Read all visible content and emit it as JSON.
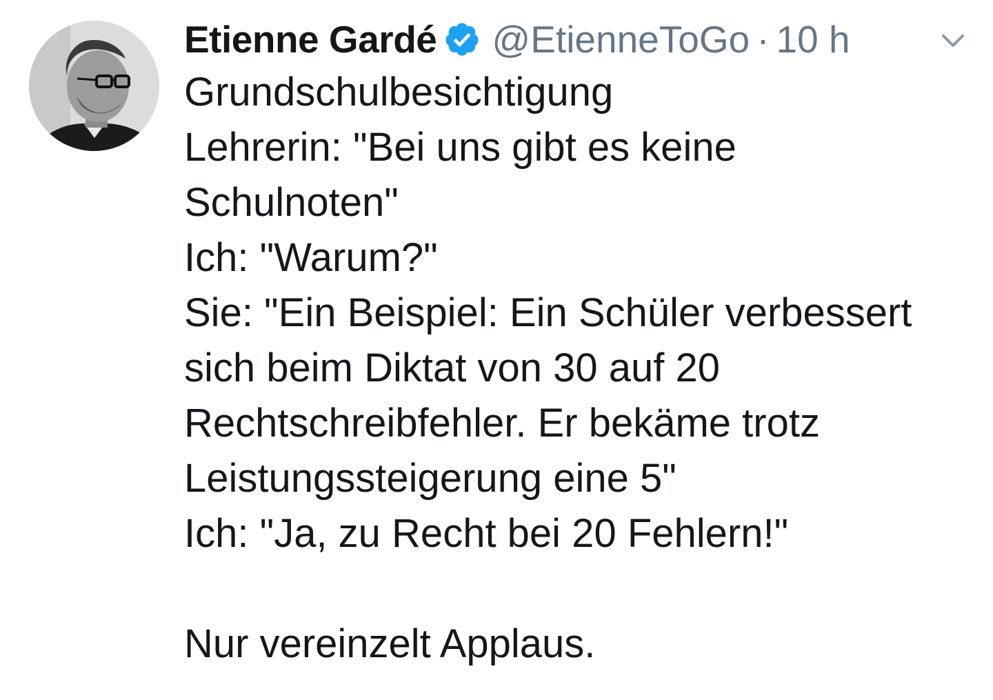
{
  "tweet": {
    "display_name": "Etienne Gardé",
    "verified": true,
    "handle": "@EtienneToGo",
    "separator": "·",
    "time": "10 h",
    "body_lines": [
      "Grundschulbesichtigung",
      "Lehrerin: \"Bei uns gibt es keine",
      "Schulnoten\"",
      "Ich: \"Warum?\"",
      "Sie: \"Ein Beispiel: Ein Schüler verbessert",
      "sich beim Diktat von 30 auf 20",
      "Rechtschreibfehler. Er bekäme trotz",
      "Leistungssteigerung eine 5\"",
      "Ich: \"Ja, zu Recht bei 20 Fehlern!\""
    ],
    "closing_line": "Nur vereinzelt Applaus."
  },
  "icons": {
    "verified": "verified-badge-icon",
    "caret": "chevron-down-icon"
  },
  "colors": {
    "verified": "#1da1f2",
    "muted": "#657786",
    "text": "#14171a"
  }
}
